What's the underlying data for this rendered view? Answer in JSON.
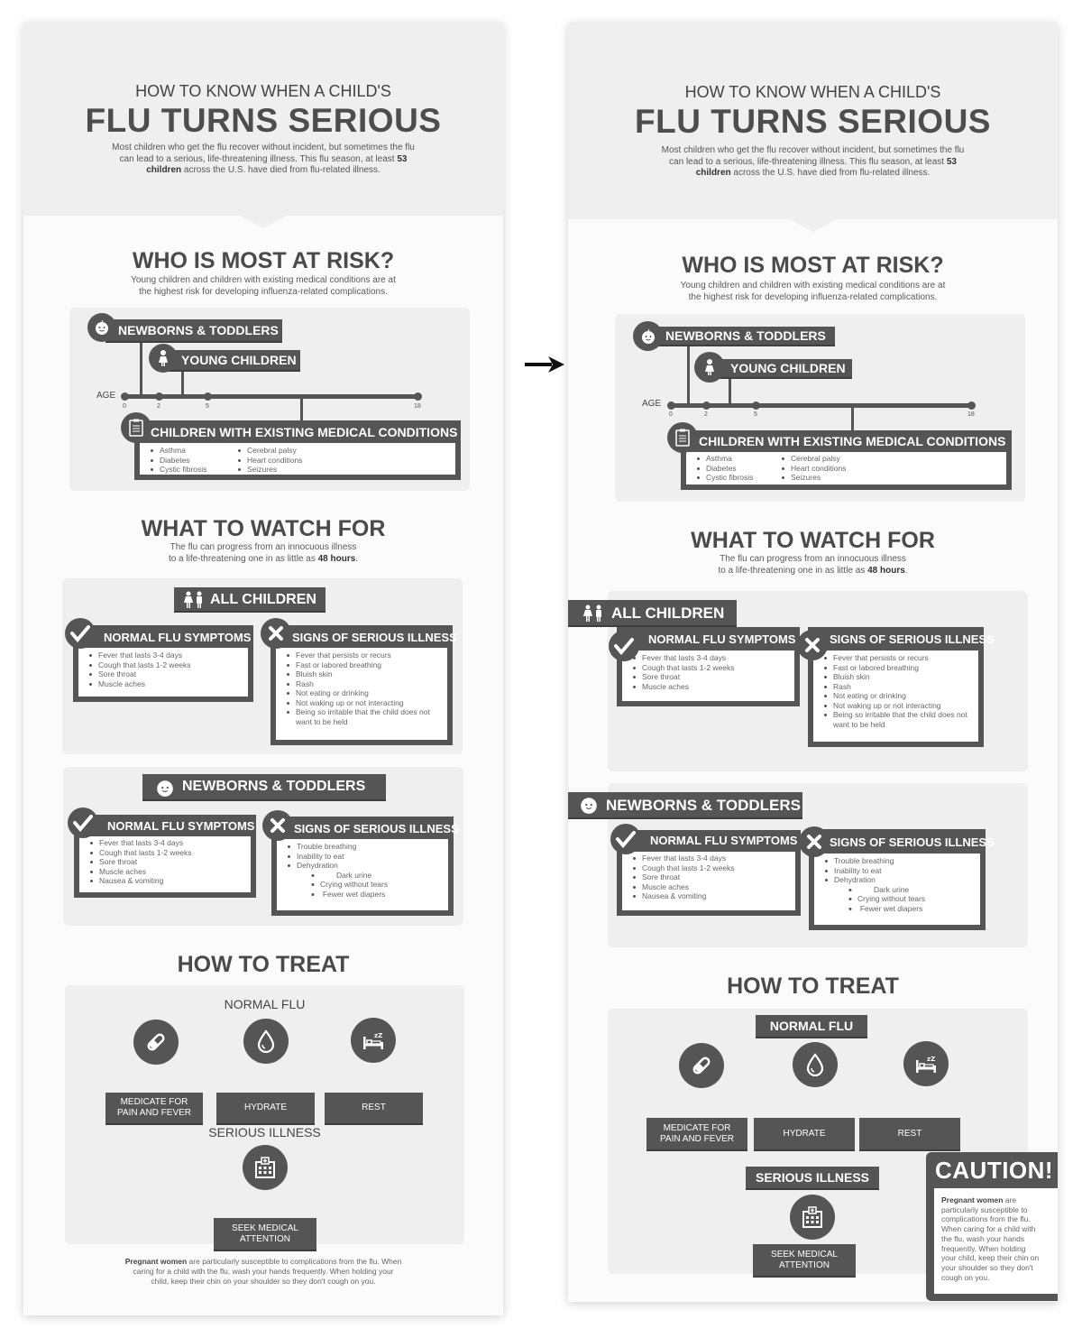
{
  "hero": {
    "super_title": "HOW TO KNOW WHEN A CHILD'S",
    "title": "FLU TURNS SERIOUS",
    "intro_pre": "Most children who get the flu recover without incident, but sometimes the flu can lead to a serious, life-threatening illness. This flu season, at least ",
    "intro_bold": "53 children",
    "intro_post": " across the U.S. have died from flu-related illness."
  },
  "risk": {
    "title": "WHO IS MOST AT RISK?",
    "subtitle_line1": "Young children and children with existing medical conditions are at",
    "subtitle_line2": "the highest risk for developing influenza-related complications.",
    "groups": {
      "newborns": {
        "label": "NEWBORNS & TODDLERS",
        "icon": "baby-face-icon"
      },
      "young": {
        "label": "YOUNG CHILDREN",
        "icon": "girl-icon"
      },
      "conditions": {
        "label": "CHILDREN WITH EXISTING MEDICAL CONDITIONS",
        "icon": "clipboard-icon"
      }
    },
    "axis_label": "AGE",
    "ticks": [
      "0",
      "2",
      "5",
      "18"
    ],
    "conditions_col1": [
      "Asthma",
      "Diabetes",
      "Cystic fibrosis"
    ],
    "conditions_col2": [
      "Cerebral palsy",
      "Heart conditions",
      "Seizures"
    ]
  },
  "watch": {
    "title": "WHAT TO WATCH FOR",
    "subtitle_line1": "The flu can progress from an innocuous illness",
    "subtitle_line2_pre": "to a life-threatening one in as little as ",
    "subtitle_line2_bold": "48 hours",
    "subtitle_line2_post": ".",
    "all_children": {
      "label": "ALL CHILDREN",
      "normal_title": "NORMAL FLU SYMPTOMS",
      "normal": [
        "Fever that lasts 3-4 days",
        "Cough that lasts 1-2 weeks",
        "Sore throat",
        "Muscle aches"
      ],
      "serious_title": "SIGNS OF SERIOUS ILLNESS",
      "serious": [
        "Fever that persists or recurs",
        "Fast or labored breathing",
        "Bluish skin",
        "Rash",
        "Not eating or drinking",
        "Not waking up or not interacting",
        "Being so irritable that the child does not want to be held"
      ]
    },
    "newborns": {
      "label": "NEWBORNS & TODDLERS",
      "normal_title": "NORMAL FLU SYMPTOMS",
      "normal": [
        "Fever that lasts 3-4 days",
        "Cough that lasts 1-2 weeks",
        "Sore throat",
        "Muscle aches",
        "Nausea & vomiting"
      ],
      "serious_title": "SIGNS OF SERIOUS ILLNESS",
      "serious": [
        "Trouble breathing",
        "Inability to eat",
        "Dehydration"
      ],
      "serious_sub": [
        "Dark urine",
        "Crying without tears",
        "Fewer wet diapers"
      ]
    }
  },
  "treat": {
    "title": "HOW TO TREAT",
    "normal_label": "NORMAL FLU",
    "actions": [
      {
        "line1": "MEDICATE FOR",
        "line2": "PAIN AND FEVER",
        "icon": "pill-icon"
      },
      {
        "line1": "HYDRATE",
        "line2": "",
        "icon": "water-drop-icon"
      },
      {
        "line1": "REST",
        "line2": "",
        "icon": "bed-sleep-icon"
      }
    ],
    "serious_label": "SERIOUS ILLNESS",
    "serious_action": {
      "line1": "SEEK MEDICAL",
      "line2": "ATTENTION",
      "icon": "hospital-icon"
    }
  },
  "footer": {
    "bold": "Pregnant women",
    "line1": " are particularly susceptible to complications from the flu. When",
    "line2": "caring for a child with the flu, wash your hands frequently. When holding your",
    "line3": "child, keep their chin on your shoulder so they don't cough on you."
  },
  "caution": {
    "title": "CAUTION!",
    "bold": "Pregnant women",
    "lines": [
      " are",
      "particularly susceptible to",
      "complications from the flu.",
      "When caring for a child with",
      "the flu, wash your hands",
      "frequently. When holding",
      "your child, keep their chin on",
      " your shoulder so they don't",
      "cough on you."
    ]
  },
  "comparison_arrow": "right-arrow-icon"
}
